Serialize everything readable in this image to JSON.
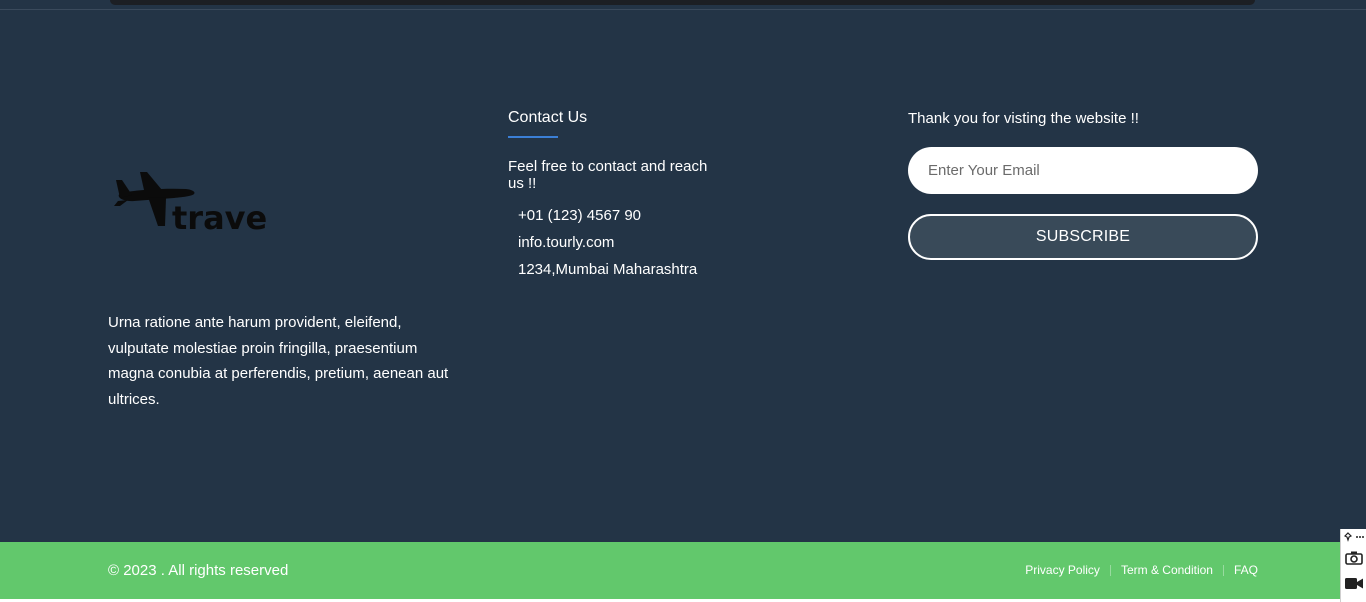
{
  "brand": {
    "logo_text": "travel",
    "about": "Urna ratione ante harum provident, eleifend, vulputate molestiae proin fringilla, praesentium magna conubia at perferendis, pretium, aenean aut ultrices."
  },
  "contact": {
    "title": "Contact Us",
    "intro": "Feel free to contact and reach us !!",
    "items": [
      {
        "label": "+01 (123) 4567 90"
      },
      {
        "label": "info.tourly.com"
      },
      {
        "label": "1234,Mumbai Maharashtra"
      }
    ]
  },
  "newsletter": {
    "thanks": "Thank you for visting the website !!",
    "email_placeholder": "Enter Your Email",
    "email_value": "",
    "subscribe_label": "SUBSCRIBE"
  },
  "bottom_bar": {
    "copyright": "© 2023 . All rights reserved",
    "links": [
      {
        "label": "Privacy Policy"
      },
      {
        "label": "Term & Condition"
      },
      {
        "label": "FAQ"
      }
    ]
  },
  "tool_widget": {
    "icons": [
      "pin-icon",
      "more-dots-icon",
      "camera-icon",
      "video-camera-icon"
    ]
  },
  "colors": {
    "footer_bg": "#233446",
    "bottom_bar_bg": "#62c86c",
    "accent_underline": "#3b7fd6",
    "subscribe_bg": "#394a59"
  }
}
